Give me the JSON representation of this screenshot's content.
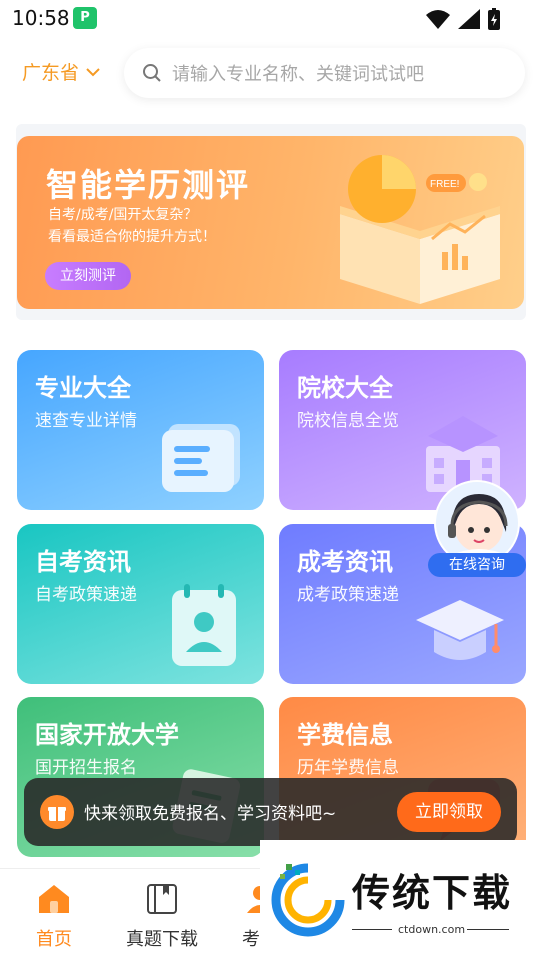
{
  "status_bar": {
    "time": "10:58",
    "app_badge": "P"
  },
  "header": {
    "location": "广东省",
    "search_placeholder": "请输入专业名称、关键词试试吧"
  },
  "banner": {
    "title": "智能学历测评",
    "subtitle_1": "自考/成考/国开太复杂？",
    "subtitle_2": "看看最适合你的提升方式！",
    "button": "立刻测评",
    "badge": "FREE!"
  },
  "cards": [
    {
      "title": "专业大全",
      "subtitle": "速查专业详情",
      "icon": "document-icon"
    },
    {
      "title": "院校大全",
      "subtitle": "院校信息全览",
      "icon": "school-icon"
    },
    {
      "title": "自考资讯",
      "subtitle": "自考政策速递",
      "icon": "calendar-person-icon"
    },
    {
      "title": "成考资讯",
      "subtitle": "成考政策速递",
      "icon": "graduation-cap-icon"
    },
    {
      "title": "国家开放大学",
      "subtitle": "国开招生报名",
      "icon": "clipboard-icon"
    },
    {
      "title": "学费信息",
      "subtitle": "历年学费信息",
      "icon": "chat-bubble-icon"
    }
  ],
  "consult": {
    "label": "在线咨询"
  },
  "promo": {
    "text": "快来领取免费报名、学习资料吧~",
    "button": "立即领取"
  },
  "bottom_nav": [
    {
      "label": "首页",
      "icon": "home-icon",
      "active": true
    },
    {
      "label": "真题下载",
      "icon": "book-icon",
      "active": false
    },
    {
      "label": "考生",
      "icon": "user-icon",
      "active": false
    }
  ],
  "watermark": {
    "text": "传统下载",
    "url": "ctdown.com"
  },
  "colors": {
    "accent": "#ff8a1f",
    "location": "#f59a23",
    "promo_button": "#ff6a1a"
  }
}
